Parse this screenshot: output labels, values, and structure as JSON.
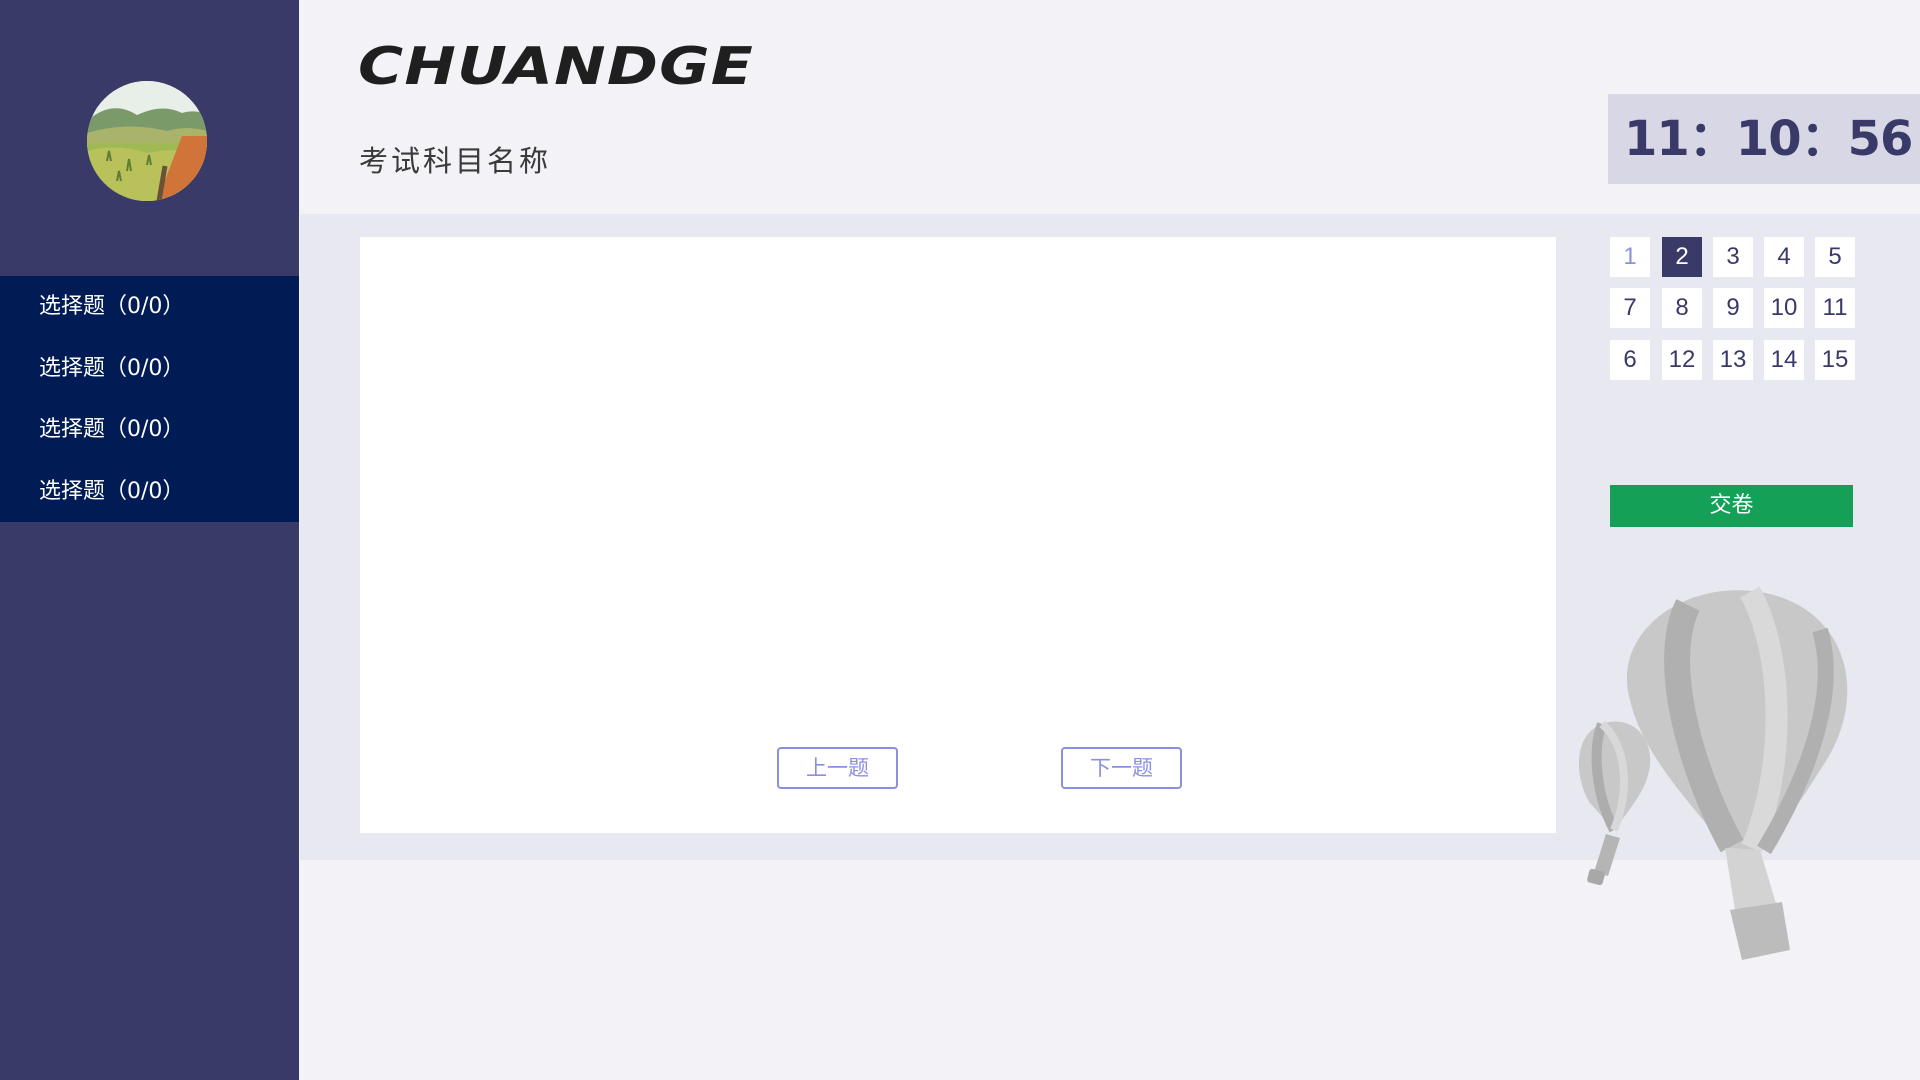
{
  "brand": {
    "logo_text": "CHUANDGE"
  },
  "exam": {
    "title": "考试科目名称"
  },
  "timer": {
    "display": "11：10：56"
  },
  "sidebar": {
    "sections": [
      {
        "label": "选择题（0/0）"
      },
      {
        "label": "选择题（0/0）"
      },
      {
        "label": "选择题（0/0）"
      },
      {
        "label": "选择题（0/0）"
      }
    ]
  },
  "navigation": {
    "prev_label": "上一题",
    "next_label": "下一题"
  },
  "answer_sheet": {
    "numbers": [
      {
        "label": "1",
        "state": "answered"
      },
      {
        "label": "2",
        "state": "current"
      },
      {
        "label": "3",
        "state": "default"
      },
      {
        "label": "4",
        "state": "default"
      },
      {
        "label": "5",
        "state": "default"
      },
      {
        "label": "7",
        "state": "default"
      },
      {
        "label": "8",
        "state": "default"
      },
      {
        "label": "9",
        "state": "default"
      },
      {
        "label": "10",
        "state": "default"
      },
      {
        "label": "11",
        "state": "default"
      },
      {
        "label": "6",
        "state": "default"
      },
      {
        "label": "12",
        "state": "default"
      },
      {
        "label": "13",
        "state": "default"
      },
      {
        "label": "14",
        "state": "default"
      },
      {
        "label": "15",
        "state": "default"
      }
    ],
    "submit_label": "交卷"
  },
  "colors": {
    "sidebar": "#393a68",
    "section_band": "#011b55",
    "accent_current": "#393a68",
    "submit": "#14a057",
    "nav_button": "#8a8fe0"
  },
  "icons": [
    "avatar-landscape-photo",
    "hot-air-balloon-decoration"
  ]
}
